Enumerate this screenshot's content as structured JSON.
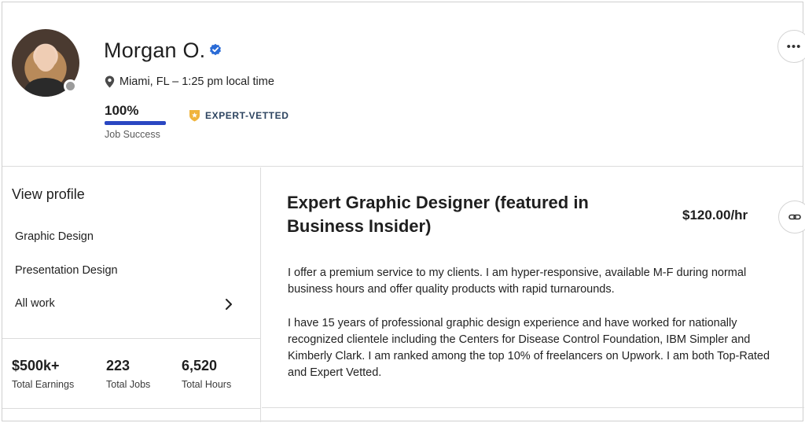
{
  "profile": {
    "name": "Morgan O.",
    "location": "Miami, FL – 1:25 pm local time",
    "job_success": {
      "value": "100%",
      "fraction": 1.0,
      "label": "Job Success"
    },
    "badge": "EXPERT-VETTED",
    "more_label": "•••"
  },
  "sidebar": {
    "heading": "View profile",
    "items": [
      {
        "label": "Graphic Design"
      },
      {
        "label": "Presentation Design"
      },
      {
        "label": "All work"
      }
    ]
  },
  "stats": [
    {
      "value": "$500k+",
      "label": "Total Earnings"
    },
    {
      "value": "223",
      "label": "Total Jobs"
    },
    {
      "value": "6,520",
      "label": "Total Hours"
    }
  ],
  "main": {
    "title": "Expert Graphic Designer (featured in Business Insider)",
    "rate": "$120.00/hr",
    "paragraphs": [
      "I offer a premium service to my clients. I am hyper-responsive, available M-F during normal business hours and offer quality products with rapid turnarounds.",
      "I have 15 years of professional graphic design experience and have worked for nationally recognized clientele including the Centers for Disease Control Foundation, IBM Simpler and Kimberly Clark. I am ranked among the top 10% of freelancers on Upwork. I am both Top-Rated and Expert Vetted."
    ]
  },
  "colors": {
    "accent_blue": "#2a47c2",
    "verified_blue": "#2a6bd6",
    "badge_gold": "#f0b43c",
    "badge_text": "#2d4460"
  },
  "icons": {
    "verified": "verified-check-icon",
    "location": "map-pin-icon",
    "badge": "shield-star-icon",
    "more": "more-horizontal-icon",
    "chevron": "chevron-right-icon",
    "link": "link-icon"
  }
}
